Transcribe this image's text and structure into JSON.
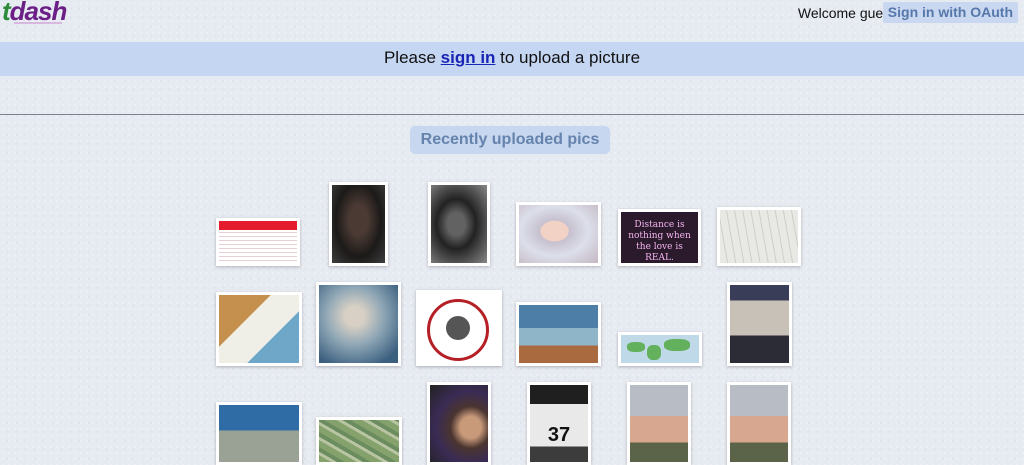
{
  "header": {
    "logo_t": "t",
    "logo_rest": "dash",
    "welcome": "Welcome guest.",
    "oauth_label": "Sign in with OAuth"
  },
  "signin_bar": {
    "prefix": "Please ",
    "link": "sign in",
    "suffix": " to upload a picture"
  },
  "section": {
    "title": "Recently uploaded pics"
  },
  "thumbnails": {
    "t5_text": "Distance is nothing when the love is REAL.",
    "t16_text": "37"
  }
}
